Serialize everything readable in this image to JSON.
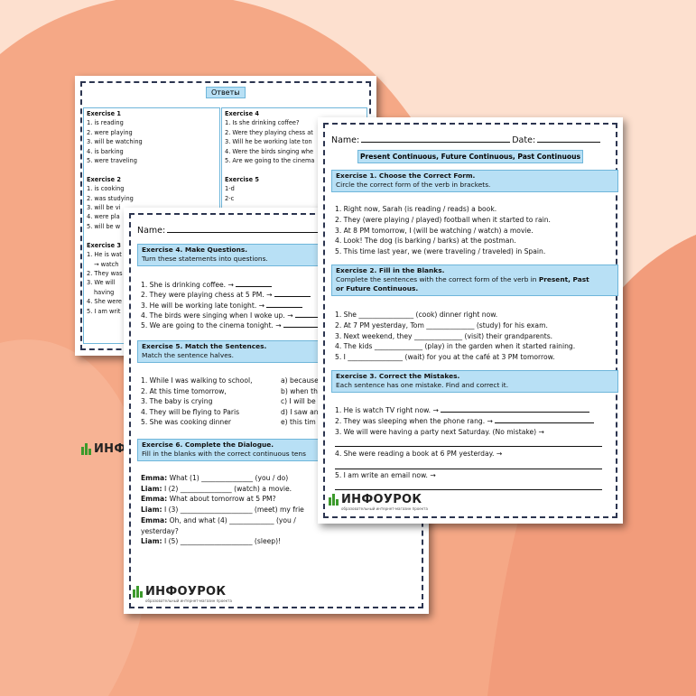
{
  "colors": {
    "background": "#fde0cf",
    "shape": "#f5a886",
    "box": "#b8e0f5",
    "logo_green": "#3c9a2c"
  },
  "logo": {
    "name": "ИНФОУРОК",
    "tagline": "образовательный интернет-магазин проекта"
  },
  "answers": {
    "title": "Ответы",
    "col1": {
      "ex1_title": "Exercise 1",
      "ex1": [
        "1. is reading",
        "2. were playing",
        "3. will be watching",
        "4. is barking",
        "5. were traveling"
      ],
      "ex2_title": "Exercise 2",
      "ex2": [
        "1. is cooking",
        "2. was studying",
        "3. will be vi",
        "4. were pla",
        "5. will be w"
      ],
      "ex3_title": "Exercise 3",
      "ex3": [
        "1. He is wat",
        "→ watch",
        "2. They was",
        "3. We will",
        "having",
        "4. She were",
        "5. I am writ"
      ]
    },
    "col2": {
      "ex4_title": "Exercise 4",
      "ex4": [
        "1. Is she drinking coffee?",
        "2. Were they playing chess at",
        "3. Will he be working late ton",
        "4. Were the birds singing whe",
        "5. Are we going to the cinema"
      ],
      "ex5_title": "Exercise 5",
      "ex5": [
        "1-d",
        "2-c"
      ]
    }
  },
  "middle": {
    "name_label": "Name:",
    "name_tail": "D",
    "ex4_title": "Exercise 4. Make Questions.",
    "ex4_instr": "Turn these statements into questions.",
    "ex4": [
      "1. She is drinking coffee. →",
      "2. They were playing chess at 5 PM. →",
      "3. He will be working late tonight. →",
      "4. The birds were singing when I woke up. →",
      "5. We are going to the cinema tonight. →"
    ],
    "ex5_title": "Exercise 5. Match the Sentences.",
    "ex5_instr": "Match the sentence halves.",
    "ex5_left": [
      "1. While I was walking to school,",
      "2. At this time tomorrow,",
      "3. The baby is crying",
      "4. They will be flying to Paris",
      "5. She was cooking dinner"
    ],
    "ex5_right": [
      "a) because",
      "b) when th",
      "c) I will be",
      "d) I saw an",
      "e) this tim"
    ],
    "ex6_title": "Exercise 6. Complete the Dialogue.",
    "ex6_instr": "Fill in the blanks with the correct continuous tens",
    "dialogue": [
      {
        "speaker": "Emma:",
        "text": "What (1) _______________ (you / do)"
      },
      {
        "speaker": "Liam:",
        "text": "I (2) _______________ (watch) a movie."
      },
      {
        "speaker": "Emma:",
        "text": "What about tomorrow at 5 PM?"
      },
      {
        "speaker": "Liam:",
        "text": "I (3) _____________________ (meet) my frie"
      },
      {
        "speaker": "Emma:",
        "text": "Oh, and what (4) _____________ (you /"
      },
      {
        "speaker": "",
        "text": "yesterday?"
      },
      {
        "speaker": "Liam:",
        "text": "I (5) _____________________ (sleep)!"
      }
    ]
  },
  "front": {
    "name_label": "Name:",
    "date_label": "Date:",
    "title": "Present Continuous, Future Continuous, Past Continuous",
    "ex1_title": "Exercise 1. Choose the Correct Form.",
    "ex1_instr": "Circle the correct form of the verb in brackets.",
    "ex1": [
      "1. Right now, Sarah (is reading / reads) a book.",
      "2. They (were playing / played) football when it started to rain.",
      "3. At 8 PM tomorrow, I (will be watching / watch) a movie.",
      "4. Look! The dog (is barking / barks) at the postman.",
      "5. This time last year, we (were traveling / traveled) in Spain."
    ],
    "ex2_title": "Exercise 2. Fill in the Blanks.",
    "ex2_instr_a": "Complete the sentences with the correct form of the verb in ",
    "ex2_instr_b": "Present, Past",
    "ex2_instr_c": "or Future Continuous.",
    "ex2": [
      "1. She ________________ (cook) dinner right now.",
      "2. At 7 PM yesterday, Tom ______________ (study) for his exam.",
      "3. Next weekend, they ______________ (visit) their grandparents.",
      "4. The kids ______________ (play) in the garden when it started raining.",
      "5. I ________________ (wait) for you at the café at 3 PM tomorrow."
    ],
    "ex3_title": "Exercise 3. Correct the Mistakes.",
    "ex3_instr": "Each sentence has one mistake. Find and correct it.",
    "ex3": [
      "1. He is watch TV right now. →",
      "2. They was sleeping when the phone rang. →",
      "3. We will were having a party next Saturday. (No mistake) →",
      "4. She were reading a book at 6 PM yesterday. →",
      "5. I am write an email now. →"
    ]
  }
}
